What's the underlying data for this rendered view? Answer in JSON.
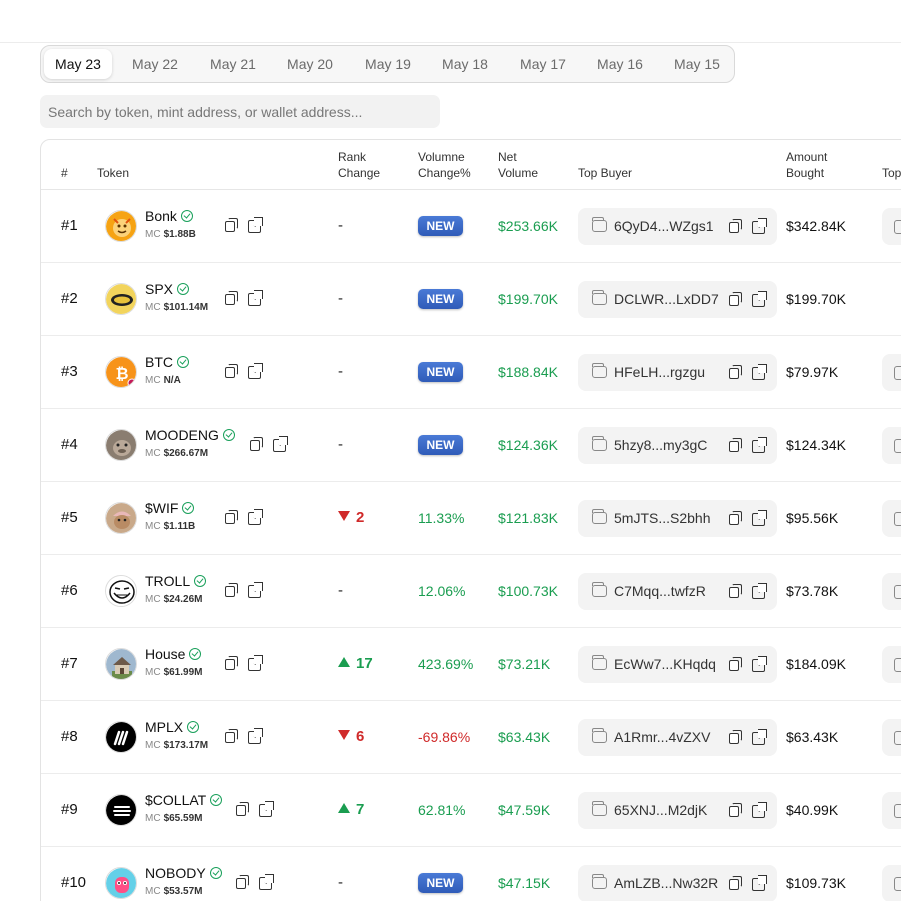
{
  "date_tabs": [
    "May 23",
    "May 22",
    "May 21",
    "May 20",
    "May 19",
    "May 18",
    "May 17",
    "May 16",
    "May 15"
  ],
  "active_tab": "May 23",
  "search": {
    "placeholder": "Search by token, mint address, or wallet address..."
  },
  "table": {
    "headers": {
      "rank": "#",
      "token": "Token",
      "rank_change": [
        "Rank",
        "Change"
      ],
      "volume_change": [
        "Volumne",
        "Change%"
      ],
      "net_volume": [
        "Net",
        "Volume"
      ],
      "top_buyer": "Top Buyer",
      "amount_bought": [
        "Amount",
        "Bought"
      ],
      "top_cut": "Top"
    },
    "mc_label": "MC",
    "rows": [
      {
        "rank": "#1",
        "name": "Bonk",
        "mc": "$1.88B",
        "rank_change": "-",
        "rank_dir": "none",
        "vol_change": "NEW",
        "vol_dir": "new",
        "net_volume": "$253.66K",
        "top_buyer": "6QyD4...WZgs1",
        "amount": "$342.84K",
        "logo": "bonk",
        "has_cut": true
      },
      {
        "rank": "#2",
        "name": "SPX",
        "mc": "$101.14M",
        "rank_change": "-",
        "rank_dir": "none",
        "vol_change": "NEW",
        "vol_dir": "new",
        "net_volume": "$199.70K",
        "top_buyer": "DCLWR...LxDD7",
        "amount": "$199.70K",
        "logo": "spx",
        "has_cut": false
      },
      {
        "rank": "#3",
        "name": "BTC",
        "mc": "N/A",
        "rank_change": "-",
        "rank_dir": "none",
        "vol_change": "NEW",
        "vol_dir": "new",
        "net_volume": "$188.84K",
        "top_buyer": "HFeLH...rgzgu",
        "amount": "$79.97K",
        "logo": "btc",
        "has_cut": true
      },
      {
        "rank": "#4",
        "name": "MOODENG",
        "mc": "$266.67M",
        "rank_change": "-",
        "rank_dir": "none",
        "vol_change": "NEW",
        "vol_dir": "new",
        "net_volume": "$124.36K",
        "top_buyer": "5hzy8...my3gC",
        "amount": "$124.34K",
        "logo": "moodeng",
        "has_cut": true
      },
      {
        "rank": "#5",
        "name": "$WIF",
        "mc": "$1.11B",
        "rank_change": "2",
        "rank_dir": "down",
        "vol_change": "11.33%",
        "vol_dir": "pos",
        "net_volume": "$121.83K",
        "top_buyer": "5mJTS...S2bhh",
        "amount": "$95.56K",
        "logo": "wif",
        "has_cut": true
      },
      {
        "rank": "#6",
        "name": "TROLL",
        "mc": "$24.26M",
        "rank_change": "-",
        "rank_dir": "none",
        "vol_change": "12.06%",
        "vol_dir": "pos",
        "net_volume": "$100.73K",
        "top_buyer": "C7Mqq...twfzR",
        "amount": "$73.78K",
        "logo": "troll",
        "has_cut": true
      },
      {
        "rank": "#7",
        "name": "House",
        "mc": "$61.99M",
        "rank_change": "17",
        "rank_dir": "up",
        "vol_change": "423.69%",
        "vol_dir": "pos",
        "net_volume": "$73.21K",
        "top_buyer": "EcWw7...KHqdq",
        "amount": "$184.09K",
        "logo": "house",
        "has_cut": true
      },
      {
        "rank": "#8",
        "name": "MPLX",
        "mc": "$173.17M",
        "rank_change": "6",
        "rank_dir": "down",
        "vol_change": "-69.86%",
        "vol_dir": "neg",
        "net_volume": "$63.43K",
        "top_buyer": "A1Rmr...4vZXV",
        "amount": "$63.43K",
        "logo": "mplx",
        "has_cut": true
      },
      {
        "rank": "#9",
        "name": "$COLLAT",
        "mc": "$65.59M",
        "rank_change": "7",
        "rank_dir": "up",
        "vol_change": "62.81%",
        "vol_dir": "pos",
        "net_volume": "$47.59K",
        "top_buyer": "65XNJ...M2djK",
        "amount": "$40.99K",
        "logo": "collat",
        "has_cut": true
      },
      {
        "rank": "#10",
        "name": "NOBODY",
        "mc": "$53.57M",
        "rank_change": "-",
        "rank_dir": "none",
        "vol_change": "NEW",
        "vol_dir": "new",
        "net_volume": "$47.15K",
        "top_buyer": "AmLZB...Nw32R",
        "amount": "$109.73K",
        "logo": "nobody",
        "has_cut": true
      }
    ]
  }
}
